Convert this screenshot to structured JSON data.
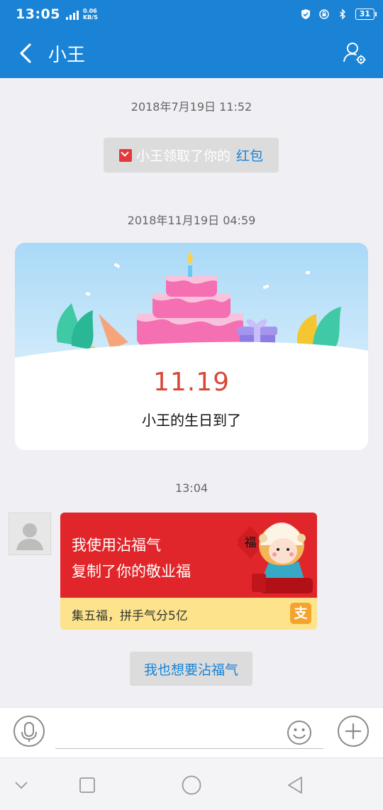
{
  "status_bar": {
    "time": "13:05",
    "network_type": "4G",
    "net_speed_value": "0.06",
    "net_speed_unit": "KB/S",
    "battery": "31"
  },
  "header": {
    "title": "小王"
  },
  "chat": {
    "messages": [
      {
        "timestamp": "2018年7月19日 11:52",
        "type": "notice",
        "text": "小王领取了你的",
        "link": "红包"
      },
      {
        "timestamp": "2018年11月19日 04:59",
        "type": "birthday_card",
        "date": "11.19",
        "text": "小王的生日到了"
      },
      {
        "timestamp": "13:04",
        "type": "fu_card",
        "line1": "我使用沾福气",
        "line2": "复制了你的敬业福",
        "badge": "福",
        "footer": "集五福，拼手气分5亿",
        "footer_icon": "支"
      }
    ],
    "action_button": "我也想要沾福气"
  },
  "input_bar": {
    "placeholder": ""
  },
  "colors": {
    "brand_blue": "#1a83d6",
    "fu_red": "#e0262a",
    "fu_yellow": "#fde48c",
    "date_red": "#d94736"
  },
  "icons": {
    "back": "chevron-left-icon",
    "settings": "user-settings-icon",
    "mic": "microphone-icon",
    "emoji": "smiley-icon",
    "plus": "plus-icon",
    "envelope": "red-envelope-icon",
    "alipay": "alipay-icon"
  }
}
